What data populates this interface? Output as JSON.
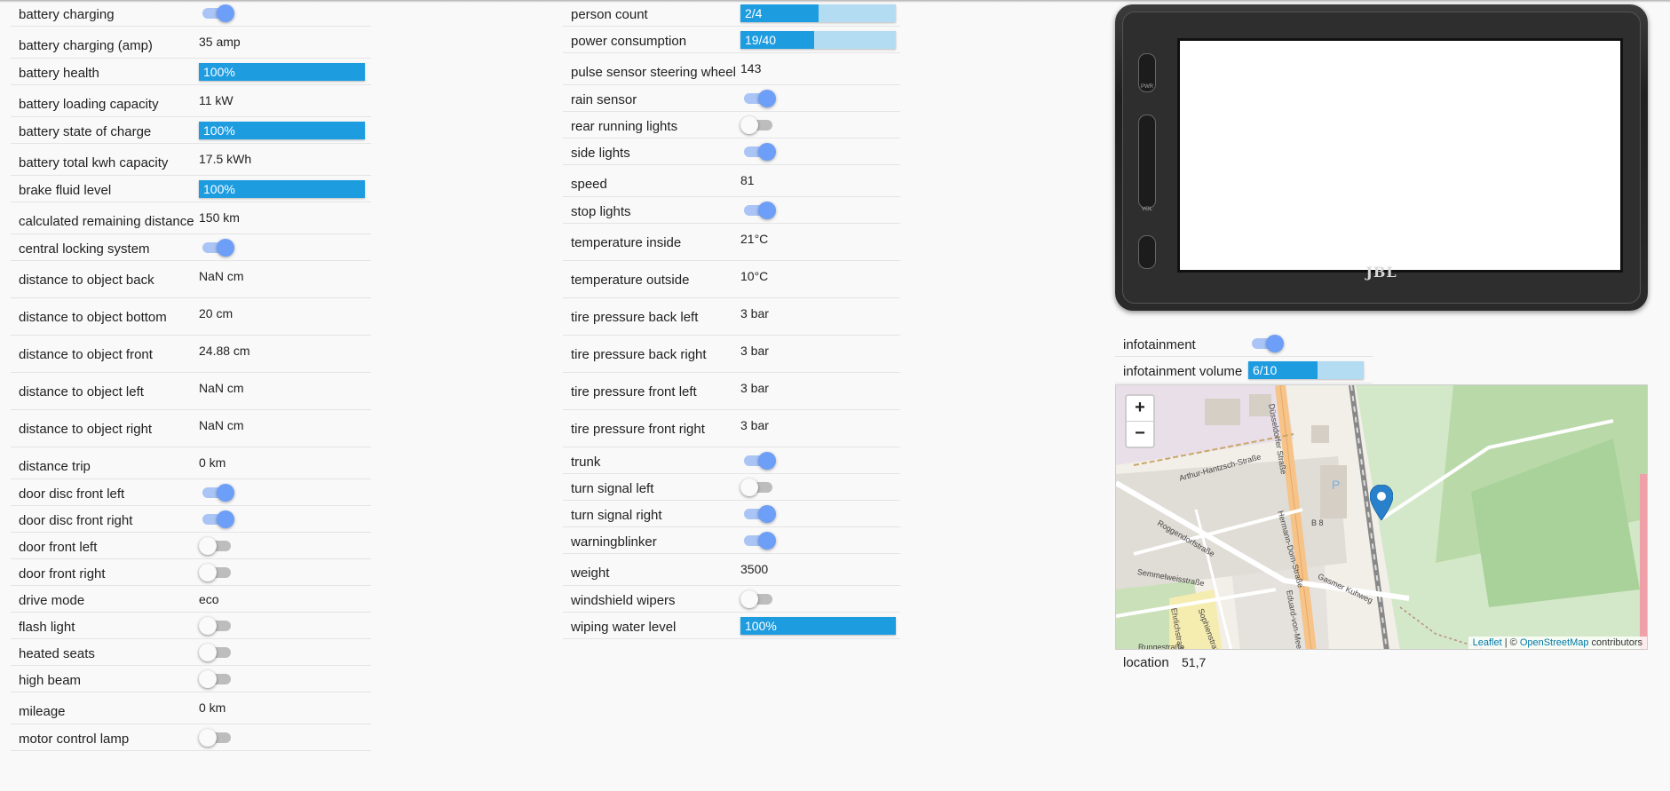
{
  "left_column": [
    {
      "label": "battery charging",
      "type": "toggle",
      "on": true
    },
    {
      "label": "battery charging (amp)",
      "type": "text",
      "value": "35 amp"
    },
    {
      "label": "battery health",
      "type": "bar",
      "text": "100%",
      "fraction": 1.0
    },
    {
      "label": "battery loading capacity",
      "type": "text",
      "value": "11 kW"
    },
    {
      "label": "battery state of charge",
      "type": "bar",
      "text": "100%",
      "fraction": 1.0
    },
    {
      "label": "battery total kwh capacity",
      "type": "text",
      "value": "17.5 kWh"
    },
    {
      "label": "brake fluid level",
      "type": "bar",
      "text": "100%",
      "fraction": 1.0
    },
    {
      "label": "calculated remaining distance",
      "type": "text",
      "value": "150 km"
    },
    {
      "label": "central locking system",
      "type": "toggle",
      "on": true
    },
    {
      "label": "distance to object back",
      "type": "text",
      "value": "NaN cm"
    },
    {
      "label": "distance to object bottom",
      "type": "text",
      "value": "20 cm"
    },
    {
      "label": "distance to object front",
      "type": "text",
      "value": "24.88 cm"
    },
    {
      "label": "distance to object left",
      "type": "text",
      "value": "NaN cm"
    },
    {
      "label": "distance to object right",
      "type": "text",
      "value": "NaN cm"
    },
    {
      "label": "distance trip",
      "type": "text",
      "value": "0 km"
    },
    {
      "label": "door disc front left",
      "type": "toggle",
      "on": true
    },
    {
      "label": "door disc front right",
      "type": "toggle",
      "on": true
    },
    {
      "label": "door front left",
      "type": "toggle",
      "on": false
    },
    {
      "label": "door front right",
      "type": "toggle",
      "on": false
    },
    {
      "label": "drive mode",
      "type": "plain",
      "value": "eco"
    },
    {
      "label": "flash light",
      "type": "toggle",
      "on": false
    },
    {
      "label": "heated seats",
      "type": "toggle",
      "on": false
    },
    {
      "label": "high beam",
      "type": "toggle",
      "on": false
    },
    {
      "label": "mileage",
      "type": "text",
      "value": "0 km"
    },
    {
      "label": "motor control lamp",
      "type": "toggle",
      "on": false
    }
  ],
  "middle_column": [
    {
      "label": "person count",
      "type": "bar",
      "text": "2/4",
      "fraction": 0.5
    },
    {
      "label": "power consumption",
      "type": "bar",
      "text": "19/40",
      "fraction": 0.475
    },
    {
      "label": "pulse sensor steering wheel",
      "type": "text",
      "value": "143"
    },
    {
      "label": "rain sensor",
      "type": "toggle",
      "on": true
    },
    {
      "label": "rear running lights",
      "type": "toggle",
      "on": false
    },
    {
      "label": "side lights",
      "type": "toggle",
      "on": true
    },
    {
      "label": "speed",
      "type": "text",
      "value": "81"
    },
    {
      "label": "stop lights",
      "type": "toggle",
      "on": true
    },
    {
      "label": "temperature inside",
      "type": "text",
      "value": "21°C"
    },
    {
      "label": "temperature outside",
      "type": "text",
      "value": "10°C"
    },
    {
      "label": "tire pressure back left",
      "type": "text",
      "value": "3 bar"
    },
    {
      "label": "tire pressure back right",
      "type": "text",
      "value": "3 bar"
    },
    {
      "label": "tire pressure front left",
      "type": "text",
      "value": "3 bar"
    },
    {
      "label": "tire pressure front right",
      "type": "text",
      "value": "3 bar"
    },
    {
      "label": "trunk",
      "type": "toggle",
      "on": true
    },
    {
      "label": "turn signal left",
      "type": "toggle",
      "on": false
    },
    {
      "label": "turn signal right",
      "type": "toggle",
      "on": true
    },
    {
      "label": "warningblinker",
      "type": "toggle",
      "on": true
    },
    {
      "label": "weight",
      "type": "text",
      "value": "3500"
    },
    {
      "label": "windshield wipers",
      "type": "toggle",
      "on": false
    },
    {
      "label": "wiping water level",
      "type": "bar",
      "text": "100%",
      "fraction": 1.0
    }
  ],
  "right_column": [
    {
      "label": "infotainment",
      "type": "toggle",
      "on": true
    },
    {
      "label": "infotainment volume",
      "type": "bar",
      "text": "6/10",
      "fraction": 0.6
    }
  ],
  "device": {
    "brand": "JBL",
    "button_labels": [
      "PWR",
      "VOL"
    ]
  },
  "map": {
    "zoom_in": "+",
    "zoom_out": "−",
    "attribution_link": "Leaflet",
    "attribution_sep": " | © ",
    "attribution_osm": "OpenStreetMap",
    "attribution_tail": " contributors",
    "street_labels": [
      "Düsseldorfer Straße",
      "Arthur-Hantzsch-Straße",
      "Roggendorfstraße",
      "Semmelweisstraße",
      "Hermann-Dorn-Straße",
      "Eduard-von-Meer-Straße",
      "Gasmer Kuhweg",
      "Rungestraße",
      "Ehrlichstraße",
      "Sophienstraße",
      "B 8",
      "P"
    ]
  },
  "location": {
    "label": "location",
    "value": "51,7"
  },
  "colors": {
    "bar_fill": "#1e9ce0",
    "bar_bg": "#b3dcf3",
    "toggle_on": "#6d9ef8"
  }
}
